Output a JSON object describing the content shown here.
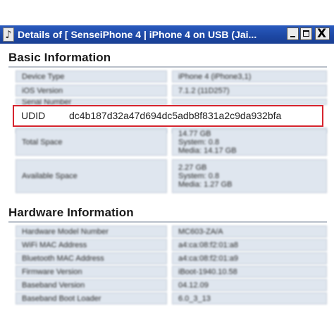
{
  "window": {
    "title": "Details of [ SenseiPhone 4 | iPhone 4 on USB (Jai...",
    "app_icon": "itunes-note-icon",
    "buttons": {
      "minimize": "_",
      "maximize": "□",
      "close": "X"
    }
  },
  "basic": {
    "heading": "Basic Information",
    "rows": [
      {
        "label": "Device Type",
        "value": "iPhone 4 (iPhone3,1)"
      },
      {
        "label": "iOS Version",
        "value": "7.1.2 (11D257)"
      },
      {
        "label": "Serial Number",
        "value": ""
      },
      {
        "label": "",
        "value": ""
      },
      {
        "label": "Total Space",
        "value": "14.77 GB\nSystem: 0.8\nMedia: 14.17 GB"
      },
      {
        "label": "Available Space",
        "value": "2.27 GB\nSystem: 0.8\nMedia: 1.27 GB"
      }
    ],
    "udid": {
      "label": "UDID",
      "value": "dc4b187d32a47d694dc5adb8f831a2c9da932bfa"
    }
  },
  "hardware": {
    "heading": "Hardware Information",
    "rows": [
      {
        "label": "Hardware Model Number",
        "value": "MC603-ZA/A"
      },
      {
        "label": "WiFi MAC Address",
        "value": "a4:ca:08:f2:01:a8"
      },
      {
        "label": "Bluetooth MAC Address",
        "value": "a4:ca:08:f2:01:a9"
      },
      {
        "label": "Firmware Version",
        "value": "iBoot-1940.10.58"
      },
      {
        "label": "Baseband Version",
        "value": "04.12.09"
      },
      {
        "label": "Baseband Boot Loader",
        "value": "6.0_3_13"
      }
    ]
  },
  "colors": {
    "titlebar": "#1c47a3",
    "highlight_border": "#d6242e",
    "cell_bg": "#dfe6ef"
  }
}
